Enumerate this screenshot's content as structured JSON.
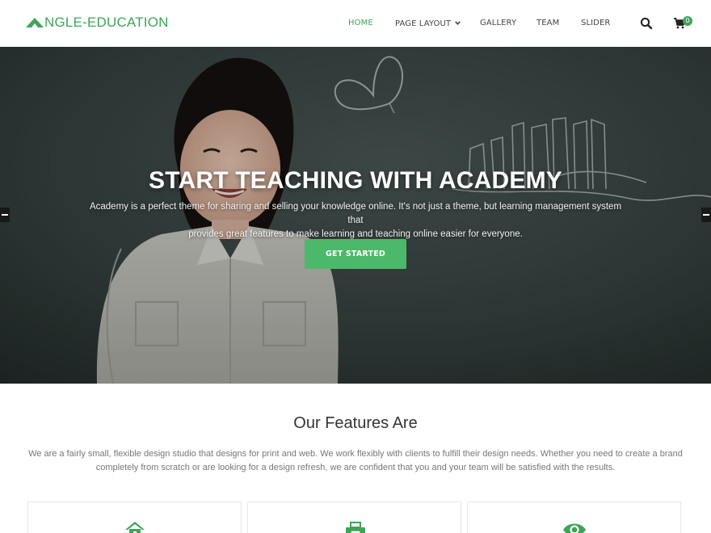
{
  "header": {
    "logo_text": "NGLE-EDUCATION",
    "logo_icon": "triangle-logo-icon",
    "accent_color": "#3ea556",
    "nav": {
      "home": "HOME",
      "page_layout": "PAGE LAYOUT",
      "gallery": "GALLERY",
      "team": "TEAM",
      "slider": "SLIDER"
    },
    "active_item": "HOME",
    "search_icon": "search-icon",
    "cart_icon": "cart-icon",
    "cart_count": "0"
  },
  "hero": {
    "title": "START TEACHING WITH ACADEMY",
    "description_line1": "Academy is a perfect theme for sharing and selling your knowledge online. It's not just a theme, but learning management system that",
    "description_line2": "provides great features to make learning and teaching online easier for everyone.",
    "cta_label": "GET STARTED",
    "cta_color": "#4cb86a",
    "prev_icon": "arrow-left-icon",
    "next_icon": "arrow-right-icon"
  },
  "features": {
    "title": "Our Features Are",
    "description_line1": "We are a fairly small, flexible design studio that designs for print and web. We work flexibly with clients to fulfill their design needs. Whether you need to create a brand",
    "description_line2": "completely from scratch or are looking for a design refresh, we are confident that you and your team will be satisfied with the results.",
    "cards": [
      {
        "icon": "home-icon"
      },
      {
        "icon": "printer-icon"
      },
      {
        "icon": "eye-icon"
      }
    ]
  }
}
